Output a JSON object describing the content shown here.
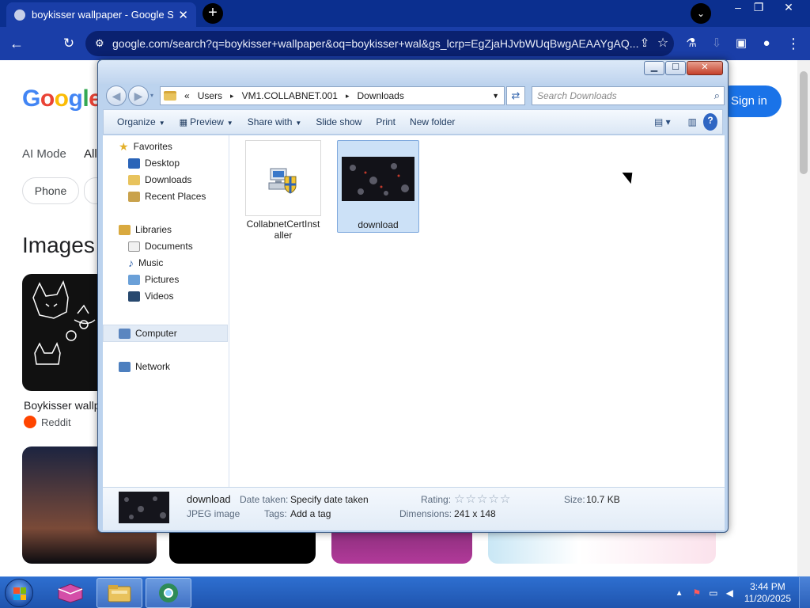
{
  "browser": {
    "tab_title": "boykisser wallpaper - Google Se",
    "tab_close": "✕",
    "new_tab": "+",
    "url": "google.com/search?q=boykisser+wallpaper&oq=boykisser+wal&gs_lcrp=EgZjaHJvbWUqBwgAEAAYgAQ..."
  },
  "google": {
    "nav_ai_mode": "AI Mode",
    "nav_all": "All",
    "chip_phone": "Phone",
    "images_heading": "Images",
    "signin": "Sign in",
    "result1_caption": "Boykisser wallp",
    "result1_source": "Reddit"
  },
  "explorer": {
    "breadcrumb": [
      "«",
      "Users",
      "▸",
      "VM1.COLLABNET.001",
      "▸",
      "Downloads"
    ],
    "search_placeholder": "Search Downloads",
    "commands": {
      "organize": "Organize",
      "preview": "Preview",
      "share_with": "Share with",
      "slide_show": "Slide show",
      "print": "Print",
      "new_folder": "New folder"
    },
    "nav": {
      "favorites": "Favorites",
      "desktop": "Desktop",
      "downloads": "Downloads",
      "recent_places": "Recent Places",
      "libraries": "Libraries",
      "documents": "Documents",
      "music": "Music",
      "pictures": "Pictures",
      "videos": "Videos",
      "computer": "Computer",
      "network": "Network"
    },
    "files": [
      {
        "name_line1": "CollabnetCertInst",
        "name_line2": "aller",
        "icon": "installer-icon",
        "selected": false
      },
      {
        "name_line1": "download",
        "name_line2": "",
        "icon": "image-thumbnail",
        "selected": true
      }
    ],
    "details": {
      "name": "download",
      "type": "JPEG image",
      "date_taken_label": "Date taken:",
      "date_taken_value": "Specify date taken",
      "tags_label": "Tags:",
      "tags_value": "Add a tag",
      "rating_label": "Rating:",
      "rating_value": 0,
      "dimensions_label": "Dimensions:",
      "dimensions_value": "241 x 148",
      "size_label": "Size:",
      "size_value": "10.7 KB"
    }
  },
  "taskbar": {
    "time": "3:44 PM",
    "date": "11/20/2025"
  }
}
